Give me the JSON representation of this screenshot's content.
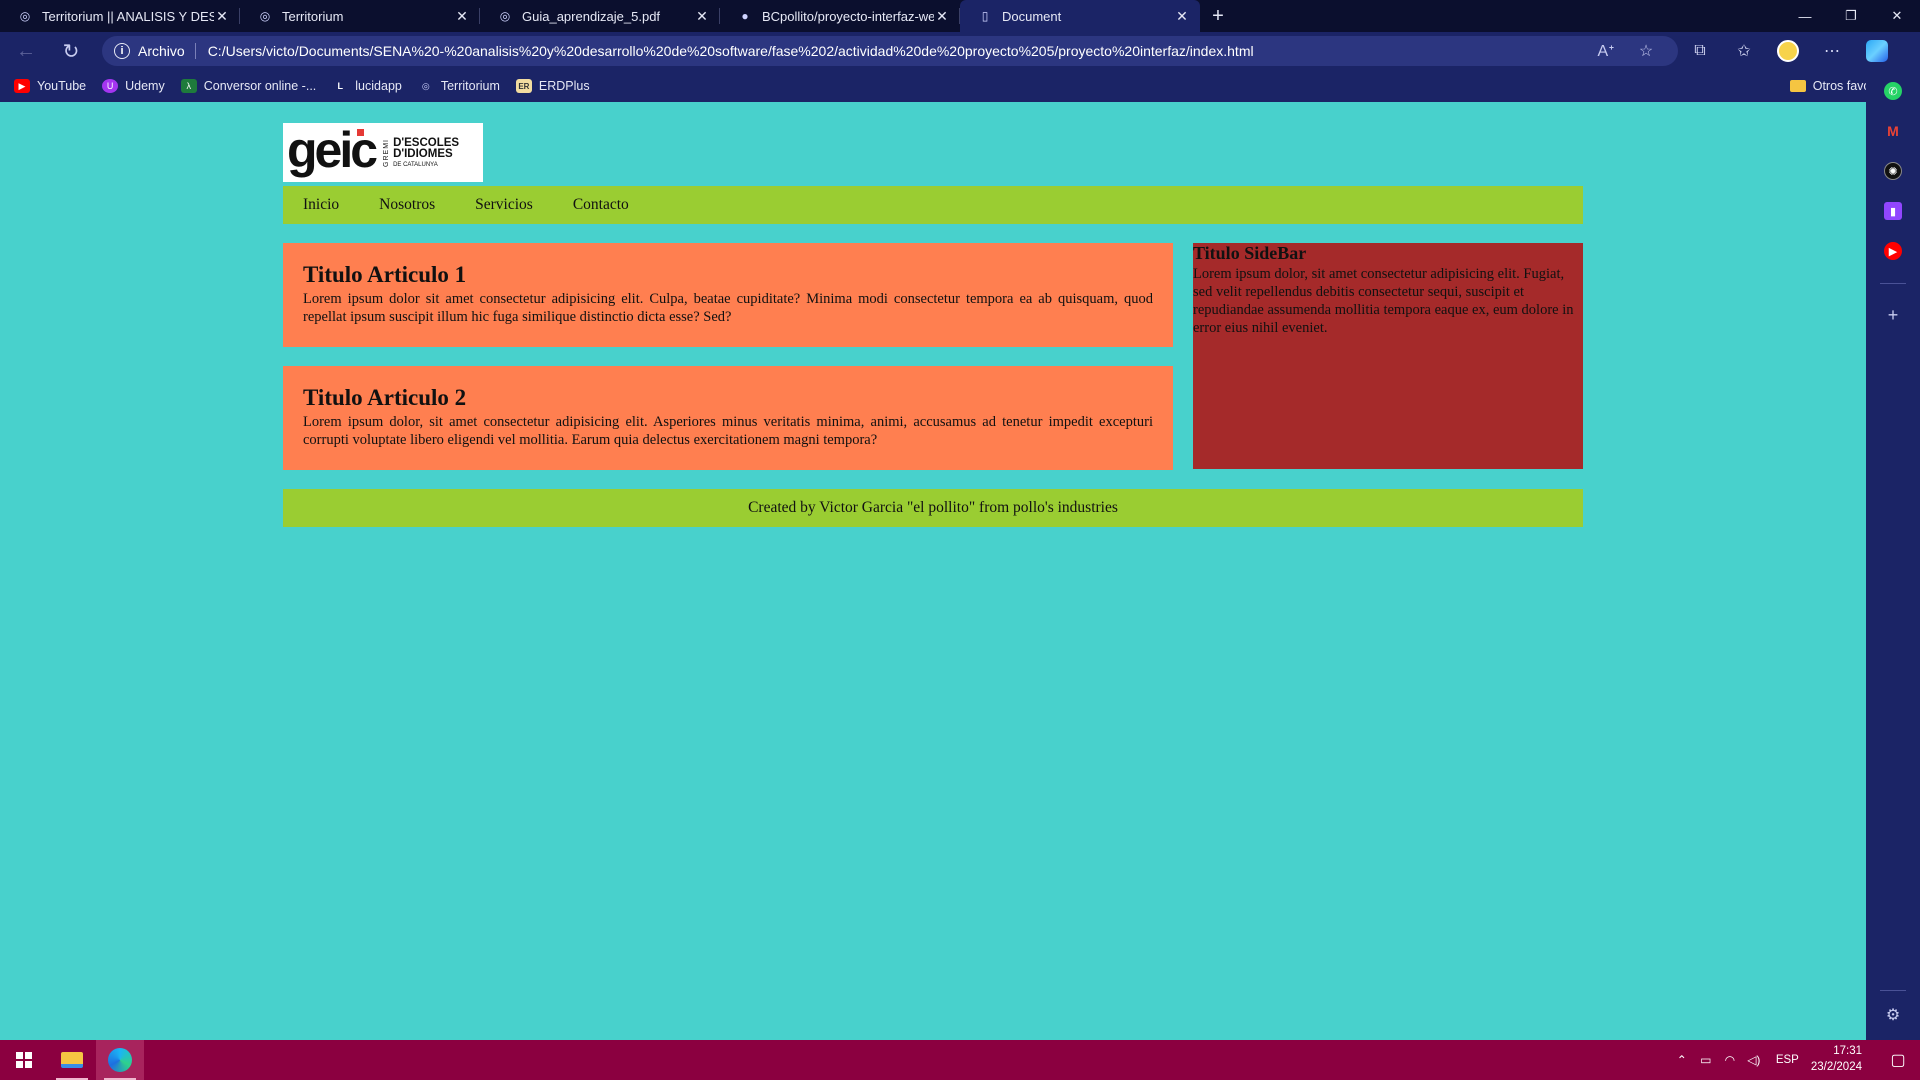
{
  "browser": {
    "tabs": [
      {
        "title": "Territorium || ANALISIS Y DESARR",
        "icon": "territorium-icon",
        "active": false
      },
      {
        "title": "Territorium",
        "icon": "territorium-icon",
        "active": false
      },
      {
        "title": "Guia_aprendizaje_5.pdf",
        "icon": "territorium-icon",
        "active": false
      },
      {
        "title": "BCpollito/proyecto-interfaz-web",
        "icon": "github-icon",
        "active": false
      },
      {
        "title": "Document",
        "icon": "document-icon",
        "active": true
      }
    ],
    "address": {
      "chip": "Archivo",
      "url": "C:/Users/victo/Documents/SENA%20-%20analisis%20y%20desarrollo%20de%20software/fase%202/actividad%20de%20proyecto%205/proyecto%20interfaz/index.html"
    },
    "bookmarks": [
      {
        "label": "YouTube",
        "icon": "youtube-icon"
      },
      {
        "label": "Udemy",
        "icon": "udemy-icon"
      },
      {
        "label": "Conversor online -...",
        "icon": "conversor-icon"
      },
      {
        "label": "lucidapp",
        "icon": "lucid-icon"
      },
      {
        "label": "Territorium",
        "icon": "territorium-icon"
      },
      {
        "label": "ERDPlus",
        "icon": "erdplus-icon"
      }
    ],
    "other_favorites": "Otros favoritos",
    "accent_color": "#1b2466"
  },
  "page": {
    "logo": {
      "mark": "geic",
      "vertical": "GREMI",
      "line1": "D'ESCOLES",
      "line2": "D'IDIOMES",
      "line3": "DE CATALUNYA"
    },
    "nav": [
      "Inicio",
      "Nosotros",
      "Servicios",
      "Contacto"
    ],
    "articles": [
      {
        "title": "Titulo Articulo 1",
        "body": "Lorem ipsum dolor sit amet consectetur adipisicing elit. Culpa, beatae cupiditate? Minima modi consectetur tempora ea ab quisquam, quod repellat ipsum suscipit illum hic fuga similique distinctio dicta esse? Sed?"
      },
      {
        "title": "Titulo Articulo 2",
        "body": "Lorem ipsum dolor, sit amet consectetur adipisicing elit. Asperiores minus veritatis minima, animi, accusamus ad tenetur impedit excepturi corrupti voluptate libero eligendi vel mollitia. Earum quia delectus exercitationem magni tempora?"
      }
    ],
    "sidebar": {
      "title": "Titulo SideBar",
      "body": "Lorem ipsum dolor, sit amet consectetur adipisicing elit. Fugiat, sed velit repellendus debitis consectetur sequi, suscipit et repudiandae assumenda mollitia tempora eaque ex, eum dolore in error eius nihil eveniet."
    },
    "footer": "Created by Victor Garcia \"el pollito\" from pollo's industries",
    "colors": {
      "background": "#48d1cc",
      "nav": "#9acd32",
      "article": "#ff7f50",
      "sidebar": "#a52a2a"
    }
  },
  "taskbar": {
    "lang": "ESP",
    "time": "17:31",
    "date": "23/2/2024",
    "color": "#8b0040"
  }
}
